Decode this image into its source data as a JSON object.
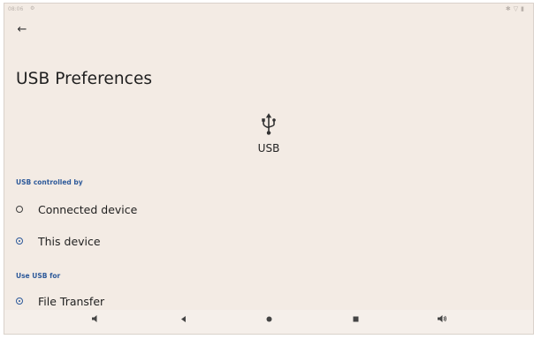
{
  "statusbar": {
    "time": "08:06",
    "left_icon": "settings-dot-icon",
    "right_icons": [
      "bluetooth-icon",
      "wifi-icon",
      "battery-icon"
    ]
  },
  "header": {
    "back_icon": "arrow-left-icon",
    "title": "USB Preferences"
  },
  "usb": {
    "icon": "usb-icon",
    "label": "USB"
  },
  "section_controlled": {
    "title": "USB controlled by",
    "options": [
      {
        "label": "Connected device",
        "checked": false
      },
      {
        "label": "This device",
        "checked": true
      }
    ]
  },
  "section_use": {
    "title": "Use USB for",
    "options": [
      {
        "label": "File Transfer",
        "checked": true
      }
    ]
  },
  "navbar": {
    "buttons": [
      "volume-down-icon",
      "back-triangle-icon",
      "home-circle-icon",
      "recents-square-icon",
      "volume-up-icon"
    ]
  },
  "colors": {
    "background": "#f3ebe4",
    "accent": "#2e5a9a"
  }
}
